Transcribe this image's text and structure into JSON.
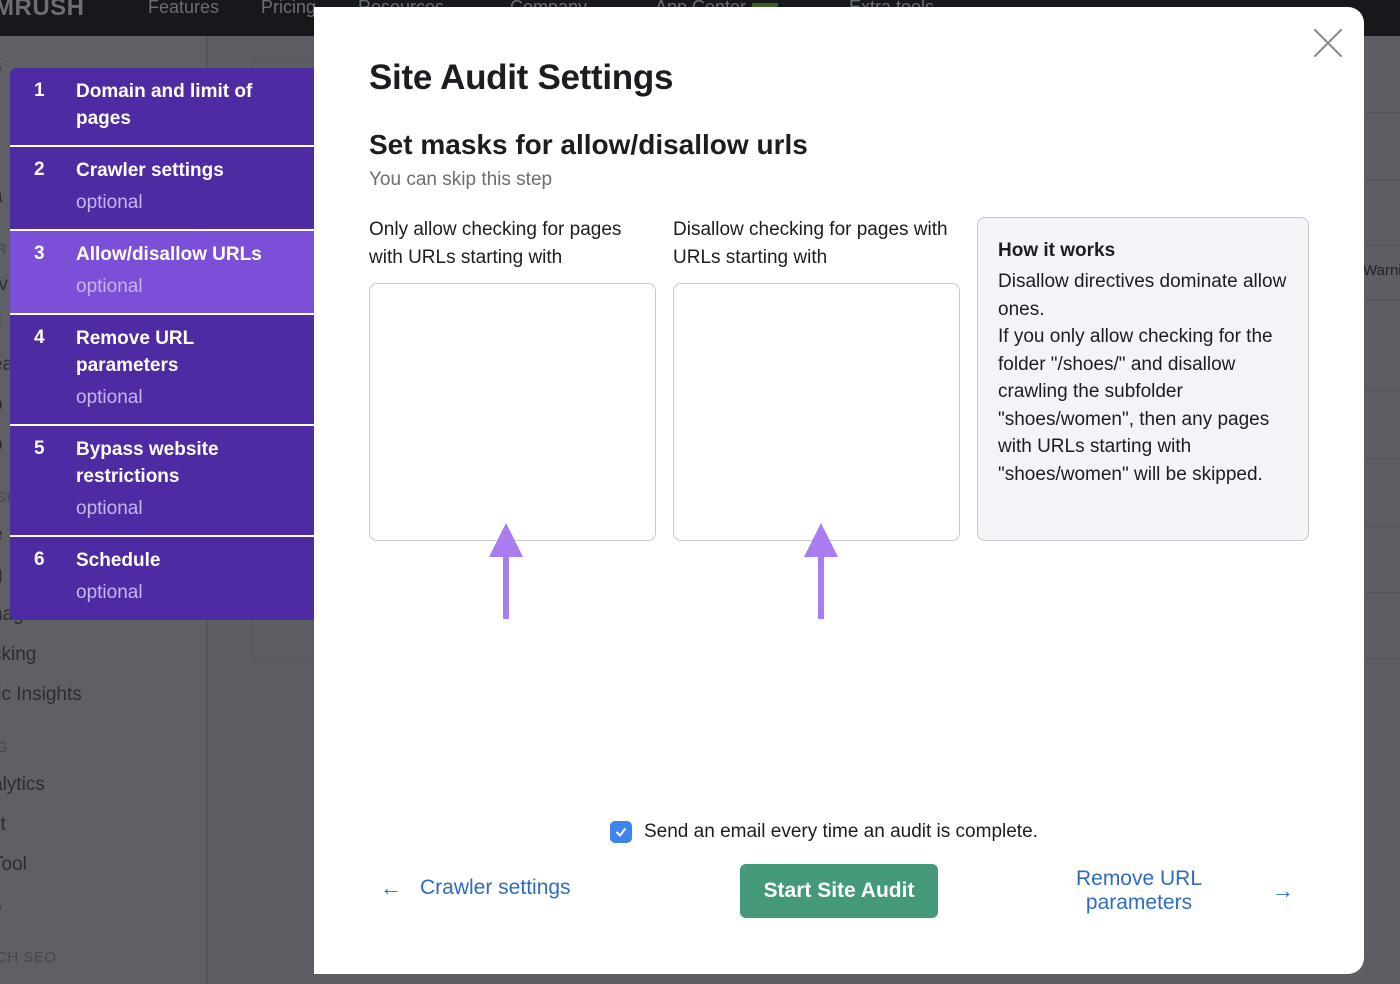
{
  "background": {
    "logo": "MRUSH",
    "nav": [
      "Features",
      "Pricing",
      "Resources",
      "Company",
      "App Center",
      "Extra tools"
    ],
    "sidebar_items": [
      "s",
      "a",
      "rv",
      "ti",
      "ea",
      "o",
      "o",
      "e",
      "g",
      "nager",
      "cking",
      "fic Insights",
      "alytics",
      "lit",
      " Tool",
      "s"
    ],
    "sidebar_sections": [
      "R",
      "SE",
      "G",
      "CH SEO"
    ],
    "right_header": "Warni"
  },
  "steps": [
    {
      "num": "1",
      "title": "Domain and limit of pages",
      "optional": ""
    },
    {
      "num": "2",
      "title": "Crawler settings",
      "optional": "optional"
    },
    {
      "num": "3",
      "title": "Allow/disallow URLs",
      "optional": "optional",
      "active": true
    },
    {
      "num": "4",
      "title": "Remove URL parameters",
      "optional": "optional"
    },
    {
      "num": "5",
      "title": "Bypass website restrictions",
      "optional": "optional"
    },
    {
      "num": "6",
      "title": "Schedule",
      "optional": "optional"
    }
  ],
  "modal": {
    "title": "Site Audit Settings",
    "section_title": "Set masks for allow/disallow urls",
    "subtitle": "You can skip this step",
    "allow_label": "Only allow checking for pages with URLs starting with",
    "allow_value": "",
    "disallow_label": "Disallow checking for pages with URLs starting with",
    "disallow_value": "",
    "hint": {
      "heading": "How it works",
      "text": "Disallow directives dominate allow ones.\nIf you only allow checking for the folder \"/shoes/\" and disallow crawling the subfolder \"shoes/women\", then any pages with URLs starting with \"shoes/women\" will be skipped."
    },
    "email_checkbox_checked": true,
    "email_label": "Send an email every time an audit is complete.",
    "back_label": "Crawler settings",
    "start_label": "Start Site Audit",
    "next_label": "Remove URL parameters"
  },
  "colors": {
    "steps_bg": "#4f2ba3",
    "step_active": "#7c4fd8",
    "primary_button": "#449a78",
    "link": "#2f6cc0",
    "checkbox": "#3b86e8",
    "annotation_arrow": "#a97cf0"
  }
}
